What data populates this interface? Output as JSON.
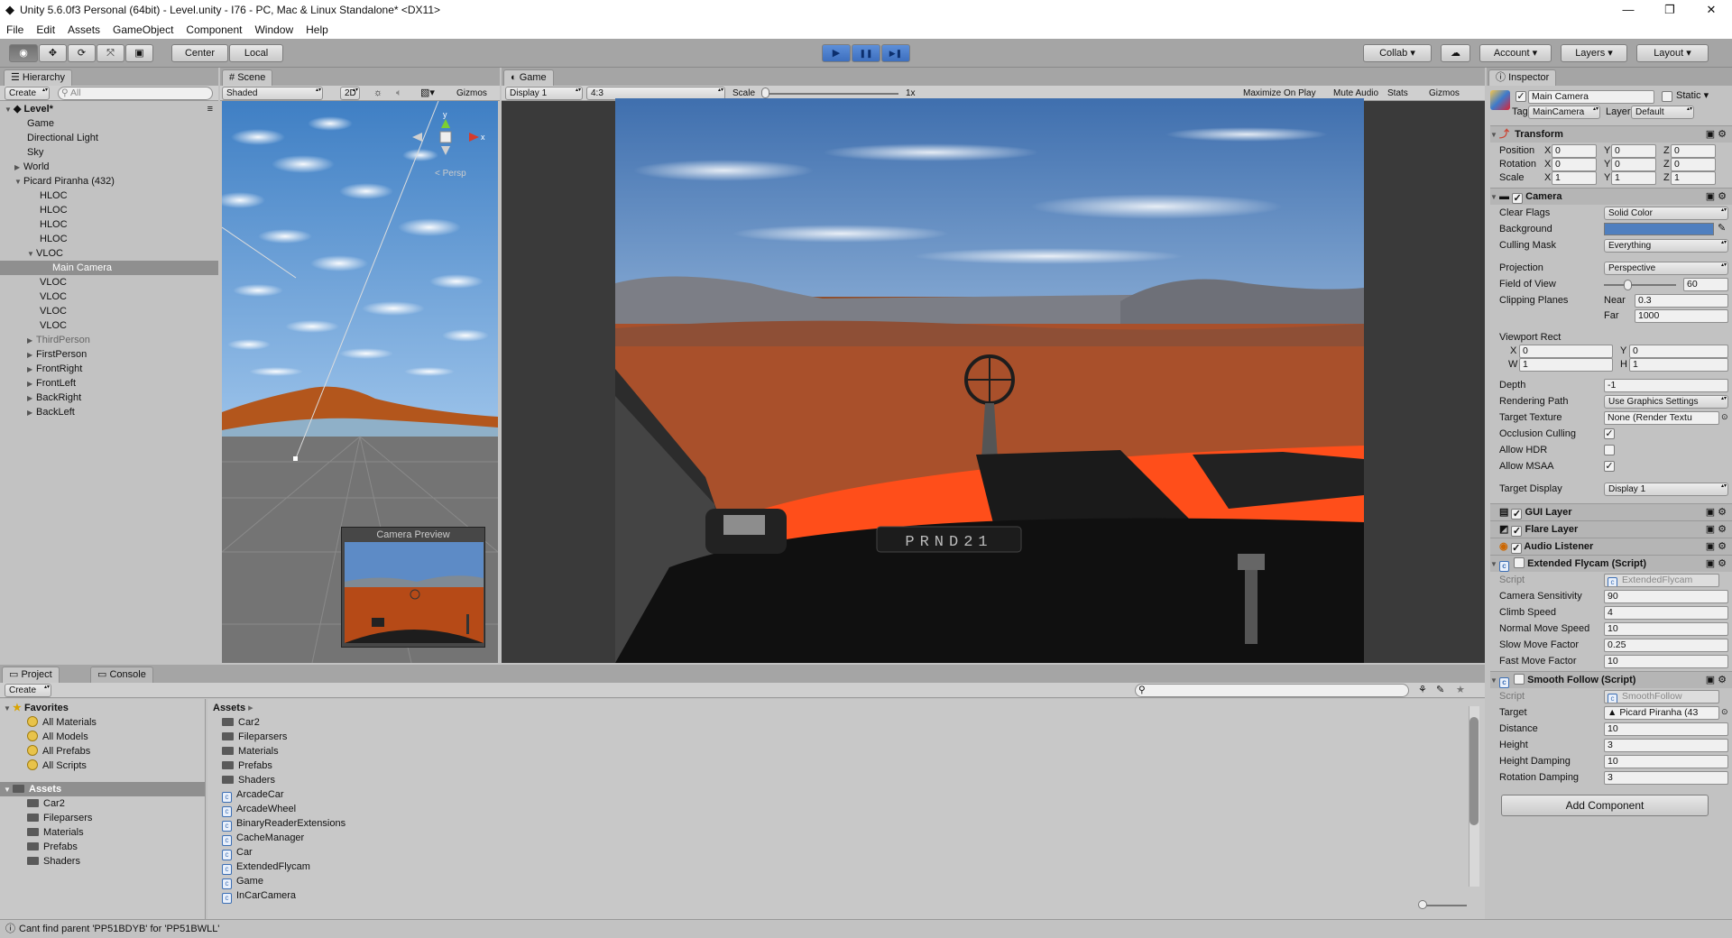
{
  "window": {
    "title": "Unity 5.6.0f3 Personal (64bit) - Level.unity - I76 - PC, Mac & Linux Standalone* <DX11>",
    "minimize": "—",
    "maximize": "❐",
    "close": "✕"
  },
  "menu": [
    "File",
    "Edit",
    "Assets",
    "GameObject",
    "Component",
    "Window",
    "Help"
  ],
  "toolbar": {
    "center_label": "Center",
    "local_label": "Local",
    "collab_label": "Collab",
    "account_label": "Account",
    "layers_label": "Layers",
    "layout_label": "Layout",
    "play_icon": "▶",
    "pause_icon": "❚❚",
    "step_icon": "▶❚"
  },
  "hierarchy": {
    "tab": "Hierarchy",
    "create": "Create",
    "search_placeholder": "All",
    "scene_name": "Level*",
    "items": [
      "Game",
      "Directional Light",
      "Sky",
      "World",
      "Picard Piranha (432)",
      "HLOC",
      "HLOC",
      "HLOC",
      "HLOC",
      "VLOC",
      "Main Camera",
      "VLOC",
      "VLOC",
      "VLOC",
      "VLOC",
      "ThirdPerson",
      "FirstPerson",
      "FrontRight",
      "FrontLeft",
      "BackRight",
      "BackLeft"
    ]
  },
  "scene": {
    "tab": "Scene",
    "shading": "Shaded",
    "mode_2d": "2D",
    "gizmos": "Gizmos",
    "persp_label": "Persp",
    "axis_y": "y",
    "axis_x": "x",
    "camera_preview": "Camera Preview"
  },
  "game": {
    "tab": "Game",
    "display": "Display 1",
    "aspect": "4:3",
    "scale_label": "Scale",
    "scale_value": "1x",
    "maximize_on_play": "Maximize On Play",
    "mute_audio": "Mute Audio",
    "stats": "Stats",
    "gizmos": "Gizmos",
    "gear_text": "PRND21"
  },
  "inspector": {
    "tab": "Inspector",
    "object_name": "Main Camera",
    "static_label": "Static",
    "tag_label": "Tag",
    "tag_value": "MainCamera",
    "layer_label": "Layer",
    "layer_value": "Default",
    "transform": {
      "title": "Transform",
      "position_label": "Position",
      "rotation_label": "Rotation",
      "scale_label": "Scale",
      "x": "X",
      "y": "Y",
      "z": "Z",
      "position": [
        "0",
        "0",
        "0"
      ],
      "rotation": [
        "0",
        "0",
        "0"
      ],
      "scale": [
        "1",
        "1",
        "1"
      ]
    },
    "camera": {
      "title": "Camera",
      "clear_flags_label": "Clear Flags",
      "clear_flags": "Solid Color",
      "background_label": "Background",
      "background_color": "#4f7fbf",
      "culling_mask_label": "Culling Mask",
      "culling_mask": "Everything",
      "projection_label": "Projection",
      "projection": "Perspective",
      "fov_label": "Field of View",
      "fov": "60",
      "fov_fraction": 0.33,
      "clipping_label": "Clipping Planes",
      "near_label": "Near",
      "near": "0.3",
      "far_label": "Far",
      "far": "1000",
      "viewport_label": "Viewport Rect",
      "vp_x_label": "X",
      "vp_x": "0",
      "vp_y_label": "Y",
      "vp_y": "0",
      "vp_w_label": "W",
      "vp_w": "1",
      "vp_h_label": "H",
      "vp_h": "1",
      "depth_label": "Depth",
      "depth": "-1",
      "rendering_path_label": "Rendering Path",
      "rendering_path": "Use Graphics Settings",
      "target_texture_label": "Target Texture",
      "target_texture": "None (Render Textu",
      "occlusion_label": "Occlusion Culling",
      "allow_hdr_label": "Allow HDR",
      "allow_msaa_label": "Allow MSAA",
      "target_display_label": "Target Display",
      "target_display": "Display 1"
    },
    "gui_layer": "GUI Layer",
    "flare_layer": "Flare Layer",
    "audio_listener": "Audio Listener",
    "flycam": {
      "title": "Extended Flycam (Script)",
      "script_label": "Script",
      "script": "ExtendedFlycam",
      "rows": [
        {
          "label": "Camera Sensitivity",
          "value": "90"
        },
        {
          "label": "Climb Speed",
          "value": "4"
        },
        {
          "label": "Normal Move Speed",
          "value": "10"
        },
        {
          "label": "Slow Move Factor",
          "value": "0.25"
        },
        {
          "label": "Fast Move Factor",
          "value": "10"
        }
      ]
    },
    "smooth": {
      "title": "Smooth Follow (Script)",
      "script_label": "Script",
      "script": "SmoothFollow",
      "target_label": "Target",
      "target": "Picard Piranha (43",
      "rows": [
        {
          "label": "Distance",
          "value": "10"
        },
        {
          "label": "Height",
          "value": "3"
        },
        {
          "label": "Height Damping",
          "value": "10"
        },
        {
          "label": "Rotation Damping",
          "value": "3"
        }
      ]
    },
    "add_component": "Add Component"
  },
  "project": {
    "tab_project": "Project",
    "tab_console": "Console",
    "create": "Create",
    "favorites_label": "Favorites",
    "favorites": [
      "All Materials",
      "All Models",
      "All Prefabs",
      "All Scripts"
    ],
    "assets_label": "Assets",
    "tree_folders": [
      "Car2",
      "Fileparsers",
      "Materials",
      "Prefabs",
      "Shaders"
    ],
    "breadcrumb": "Assets",
    "folders": [
      "Car2",
      "Fileparsers",
      "Materials",
      "Prefabs",
      "Shaders"
    ],
    "scripts": [
      "ArcadeCar",
      "ArcadeWheel",
      "BinaryReaderExtensions",
      "CacheManager",
      "Car",
      "ExtendedFlycam",
      "Game",
      "InCarCamera"
    ]
  },
  "status": "Cant find parent 'PP51BDYB' for 'PP51BWLL'"
}
